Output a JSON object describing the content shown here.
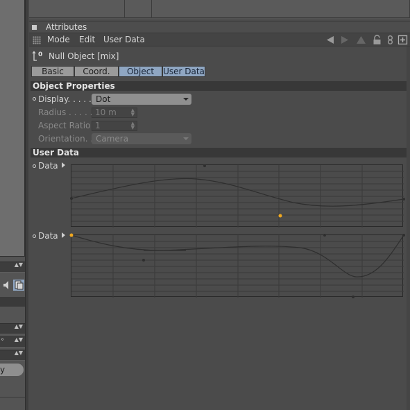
{
  "left_panel": {
    "spin_glyph": "▲▼",
    "field_units": [
      "",
      "°",
      ""
    ],
    "button_label": "y"
  },
  "attributes": {
    "title": "Attributes",
    "menu": [
      "Mode",
      "Edit",
      "User Data"
    ],
    "tools": [
      "arrow-left-icon",
      "arrow-right-icon",
      "arrow-up-icon",
      "lock-icon",
      "link-icon",
      "new-panel-icon"
    ],
    "object_name": "Null Object [mix]",
    "object_icon_glyph": "0"
  },
  "tabs": [
    {
      "label": "Basic",
      "active": false
    },
    {
      "label": "Coord.",
      "active": false
    },
    {
      "label": "Object",
      "active": true
    },
    {
      "label": "User Data",
      "active": true
    }
  ],
  "object_properties": {
    "title": "Object Properties",
    "display": {
      "label": "Display. . . . .",
      "value": "Dot"
    },
    "radius": {
      "label": "Radius . . . . .",
      "value": "10 m"
    },
    "aspect_ratio": {
      "label": "Aspect Ratio",
      "value": "1"
    },
    "orientation": {
      "label": "Orientation. .",
      "value": "Camera"
    }
  },
  "user_data": {
    "title": "User Data",
    "data1": {
      "label": "Data"
    },
    "data2": {
      "label": "Data"
    }
  },
  "colors": {
    "background": "#4b4b4b",
    "section": "#383838",
    "tab": "#9a9a9a",
    "tab_active": "#8fa6c2",
    "spline_point": "#f0a820",
    "curve": "#2e2e2e"
  }
}
